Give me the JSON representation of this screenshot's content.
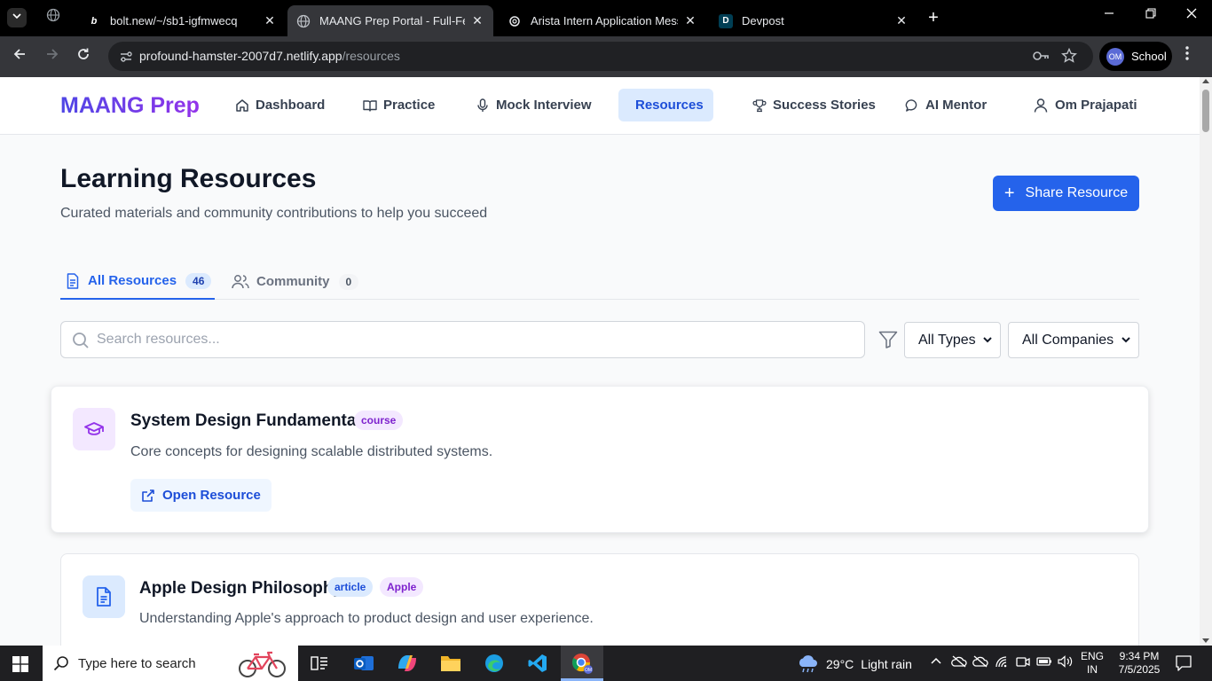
{
  "browser": {
    "tabs": [
      {
        "favicon": "b",
        "title": "bolt.new/~/sb1-igfmwecq"
      },
      {
        "favicon": "globe",
        "title": "MAANG Prep Portal - Full-Featu"
      },
      {
        "favicon": "openai",
        "title": "Arista Intern Application Messa"
      },
      {
        "favicon": "D",
        "title": "Devpost"
      }
    ],
    "url_host": "profound-hamster-2007d7.netlify.app",
    "url_path": "/resources",
    "profile_initials": "OM",
    "profile_label": "School"
  },
  "app": {
    "brand": "MAANG Prep",
    "nav": [
      {
        "label": "Dashboard",
        "icon": "home-icon"
      },
      {
        "label": "Practice",
        "icon": "book-open-icon"
      },
      {
        "label": "Mock Interview",
        "icon": "microphone-icon"
      },
      {
        "label": "Resources",
        "icon": "file-text-icon",
        "active": true
      },
      {
        "label": "Success Stories",
        "icon": "trophy-icon"
      },
      {
        "label": "AI Mentor",
        "icon": "chat-bubble-icon"
      },
      {
        "label": "Om Prajapati",
        "icon": "user-icon"
      }
    ]
  },
  "page": {
    "title": "Learning Resources",
    "subtitle": "Curated materials and community contributions to help you succeed",
    "share_button": "Share Resource",
    "tabs": [
      {
        "label": "All Resources",
        "count": "46",
        "active": true
      },
      {
        "label": "Community",
        "count": "0",
        "active": false
      }
    ],
    "search_placeholder": "Search resources...",
    "type_filter": "All Types",
    "company_filter": "All Companies"
  },
  "resources": [
    {
      "title": "System Design Fundamentals",
      "type": "course",
      "company": "",
      "description": "Core concepts for designing scalable distributed systems.",
      "action": "Open Resource",
      "icon": "graduation-cap-icon"
    },
    {
      "title": "Apple Design Philosophy",
      "type": "article",
      "company": "Apple",
      "description": "Understanding Apple's approach to product design and user experience.",
      "icon": "file-text-icon"
    }
  ],
  "taskbar": {
    "search_placeholder": "Type here to search",
    "temperature": "29°C",
    "weather": "Light rain",
    "lang_line1": "ENG",
    "lang_line2": "IN",
    "time": "9:34 PM",
    "date": "7/5/2025"
  },
  "colors": {
    "accent": "#2563eb",
    "brand_start": "#4f46e5",
    "brand_end": "#9333ea",
    "course_badge": "#7e22ce",
    "article_badge": "#1d4ed8"
  }
}
